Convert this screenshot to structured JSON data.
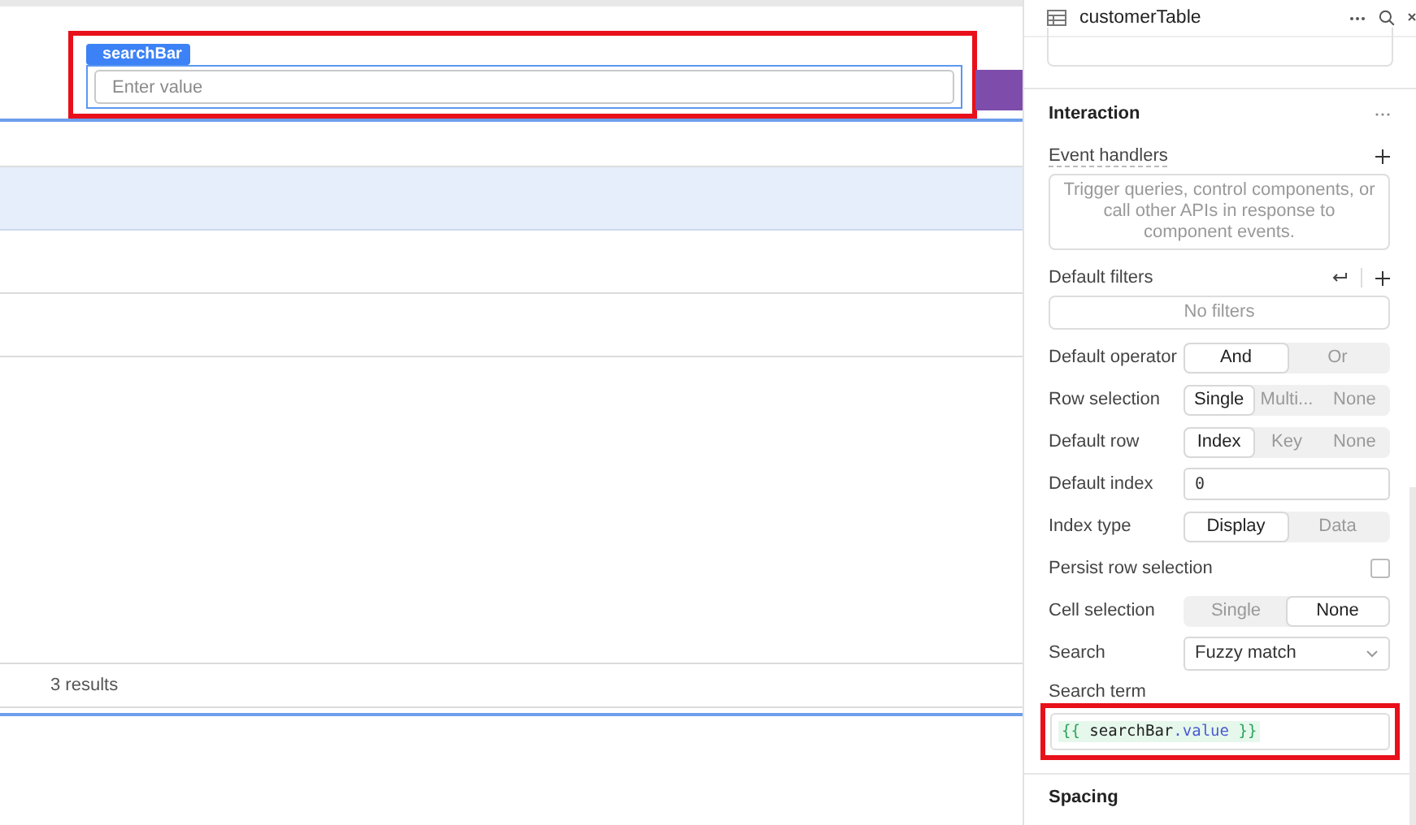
{
  "canvas": {
    "search_bar": {
      "tag": "searchBar",
      "placeholder": "Enter value",
      "highlighted": true
    },
    "table": {
      "rows": [
        {
          "selected": true
        },
        {
          "selected": false
        },
        {
          "selected": false
        }
      ],
      "footer": "3 results"
    }
  },
  "panel": {
    "title": "customerTable",
    "section": "Interaction",
    "event_handlers": {
      "label": "Event handlers",
      "empty_text": "Trigger queries, control components, or call other APIs in response to component events."
    },
    "default_filters": {
      "label": "Default filters",
      "empty_text": "No filters"
    },
    "rows": [
      {
        "kind": "segmented",
        "label": "Default operator",
        "options": [
          {
            "label": "And",
            "selected": true
          },
          {
            "label": "Or",
            "selected": false
          }
        ]
      },
      {
        "kind": "segmented",
        "label": "Row selection",
        "options": [
          {
            "label": "Single",
            "selected": true
          },
          {
            "label": "Multi...",
            "selected": false
          },
          {
            "label": "None",
            "selected": false
          }
        ]
      },
      {
        "kind": "segmented",
        "label": "Default row",
        "options": [
          {
            "label": "Index",
            "selected": true
          },
          {
            "label": "Key",
            "selected": false
          },
          {
            "label": "None",
            "selected": false
          }
        ]
      },
      {
        "kind": "input",
        "label": "Default index",
        "value": "0"
      },
      {
        "kind": "segmented",
        "label": "Index type",
        "options": [
          {
            "label": "Display",
            "selected": true
          },
          {
            "label": "Data",
            "selected": false
          }
        ]
      },
      {
        "kind": "checkbox",
        "label": "Persist row selection",
        "checked": false
      },
      {
        "kind": "segmented",
        "label": "Cell selection",
        "options": [
          {
            "label": "Single",
            "selected": false
          },
          {
            "label": "None",
            "selected": true
          }
        ]
      },
      {
        "kind": "select",
        "label": "Search",
        "value": "Fuzzy match"
      }
    ],
    "search_term": {
      "label": "Search term",
      "value": "{{ searchBar.value }}",
      "highlighted": true
    },
    "next_section": "Spacing"
  }
}
